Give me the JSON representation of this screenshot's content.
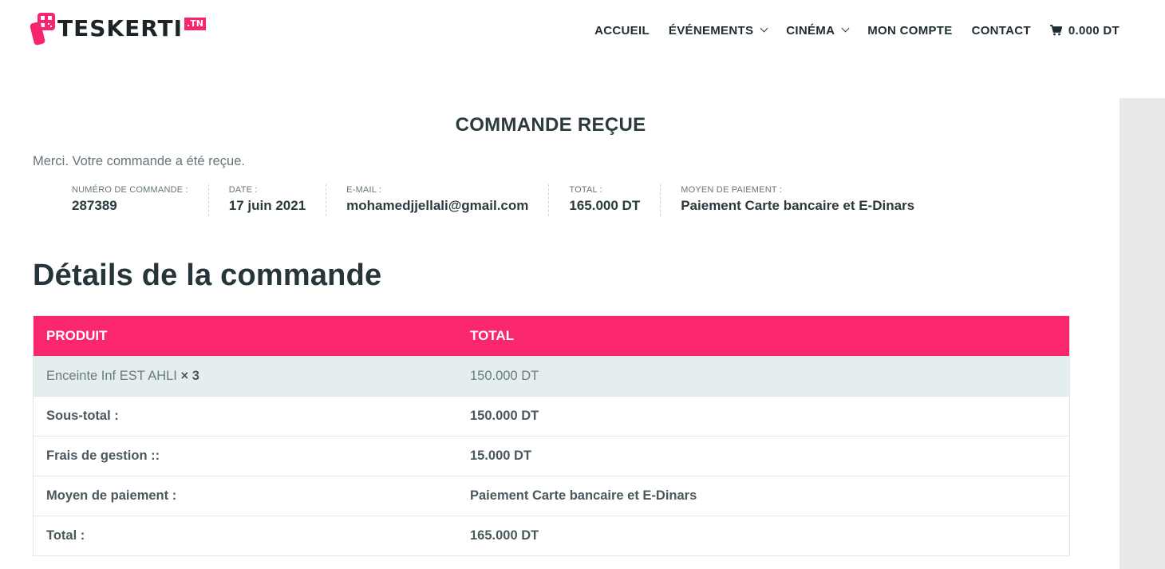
{
  "brand": {
    "name": "TESKERTI",
    "tld": ".TN",
    "accent_color": "#fb2670"
  },
  "nav": {
    "items": [
      {
        "label": "ACCUEIL",
        "has_dropdown": false
      },
      {
        "label": "ÉVÉNEMENTS",
        "has_dropdown": true
      },
      {
        "label": "CINÉMA",
        "has_dropdown": true
      },
      {
        "label": "MON COMPTE",
        "has_dropdown": false
      },
      {
        "label": "CONTACT",
        "has_dropdown": false
      }
    ],
    "cart": {
      "icon": "cart-icon",
      "total": "0.000 DT"
    }
  },
  "page": {
    "title": "COMMANDE REÇUE",
    "thanks_message": "Merci. Votre commande a été reçue."
  },
  "order_overview": [
    {
      "label": "NUMÉRO DE COMMANDE :",
      "value": "287389"
    },
    {
      "label": "DATE :",
      "value": "17 juin 2021"
    },
    {
      "label": "E-MAIL :",
      "value": "mohamedjjellali@gmail.com"
    },
    {
      "label": "TOTAL :",
      "value": "165.000 DT"
    },
    {
      "label": "MOYEN DE PAIEMENT :",
      "value": "Paiement Carte bancaire et E-Dinars"
    }
  ],
  "order_details": {
    "heading": "Détails de la commande",
    "columns": [
      "PRODUIT",
      "TOTAL"
    ],
    "items": [
      {
        "product": "Enceinte Inf EST AHLI",
        "qty_label": "× 3",
        "total": "150.000 DT"
      }
    ],
    "summary": [
      {
        "label": "Sous-total :",
        "value": "150.000 DT"
      },
      {
        "label": "Frais de gestion ::",
        "value": "15.000 DT"
      },
      {
        "label": "Moyen de paiement :",
        "value": "Paiement Carte bancaire et E-Dinars"
      },
      {
        "label": "Total :",
        "value": "165.000 DT"
      }
    ]
  }
}
